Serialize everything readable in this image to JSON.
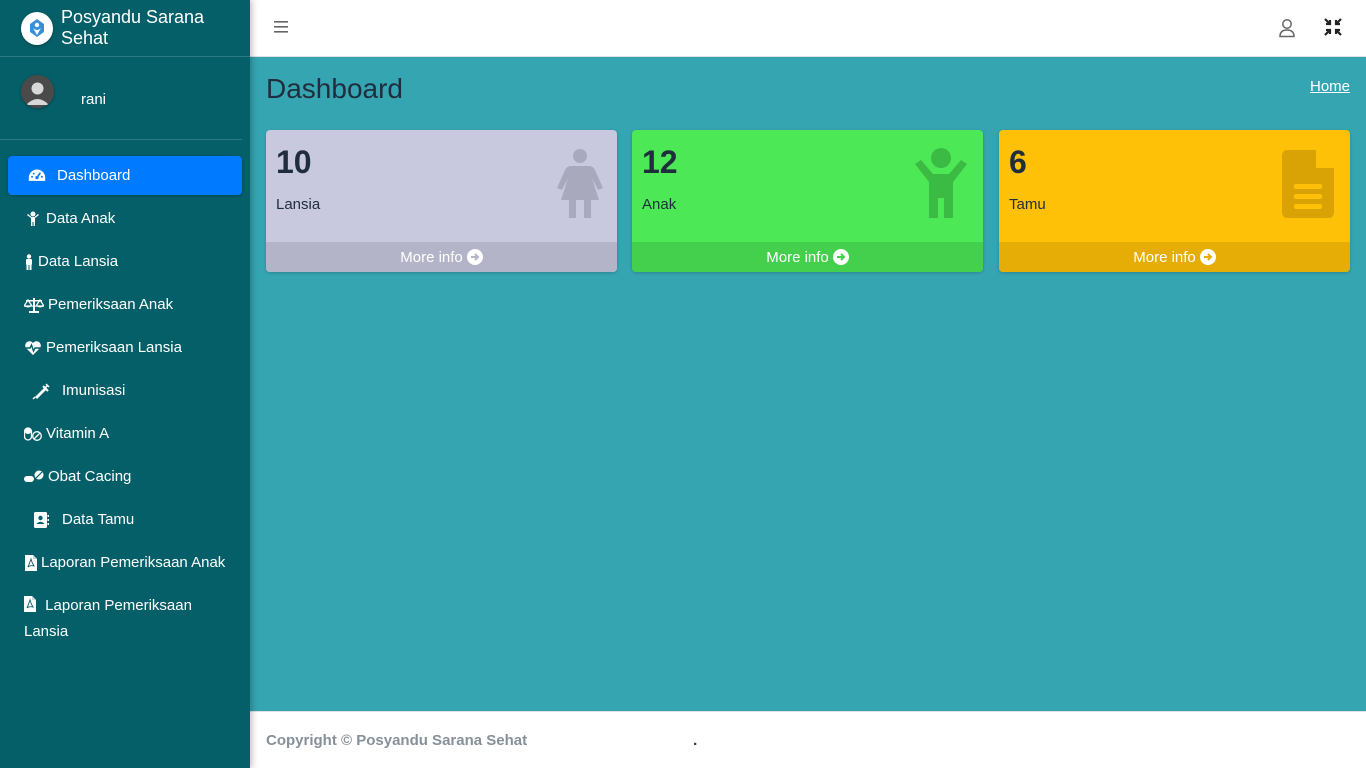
{
  "brand": {
    "name": "Posyandu Sarana Sehat"
  },
  "user": {
    "name": "rani"
  },
  "sidebar": {
    "items": [
      {
        "label": "Dashboard",
        "icon": "tachometer-icon"
      },
      {
        "label": "Data Anak",
        "icon": "child-icon"
      },
      {
        "label": "Data Lansia",
        "icon": "person-icon"
      },
      {
        "label": "Pemeriksaan Anak",
        "icon": "balance-scale-icon"
      },
      {
        "label": "Pemeriksaan Lansia",
        "icon": "heartbeat-icon"
      },
      {
        "label": "Imunisasi",
        "icon": "syringe-icon"
      },
      {
        "label": "Vitamin A",
        "icon": "capsules-icon"
      },
      {
        "label": "Obat Cacing",
        "icon": "pills-icon"
      },
      {
        "label": "Data Tamu",
        "icon": "address-book-icon"
      },
      {
        "label": "Laporan Pemeriksaan Anak",
        "icon": "file-pdf-icon"
      },
      {
        "label": "Laporan Pemeriksaan Lansia",
        "icon": "file-pdf-icon"
      }
    ]
  },
  "header": {
    "title": "Dashboard",
    "breadcrumb": "Home"
  },
  "boxes": [
    {
      "count": "10",
      "label": "Lansia",
      "more": "More info",
      "icon": "female-icon"
    },
    {
      "count": "12",
      "label": "Anak",
      "more": "More info",
      "icon": "child-icon"
    },
    {
      "count": "6",
      "label": "Tamu",
      "more": "More info",
      "icon": "file-icon"
    }
  ],
  "footer": {
    "copyright": "Copyright © Posyandu Sarana Sehat",
    "dot": "."
  },
  "colors": {
    "sidebar": "#055f69",
    "content": "#36a5b2",
    "active": "#007bff",
    "lansia": "#c8c8df",
    "anak": "#4ce855",
    "tamu": "#ffc107"
  }
}
